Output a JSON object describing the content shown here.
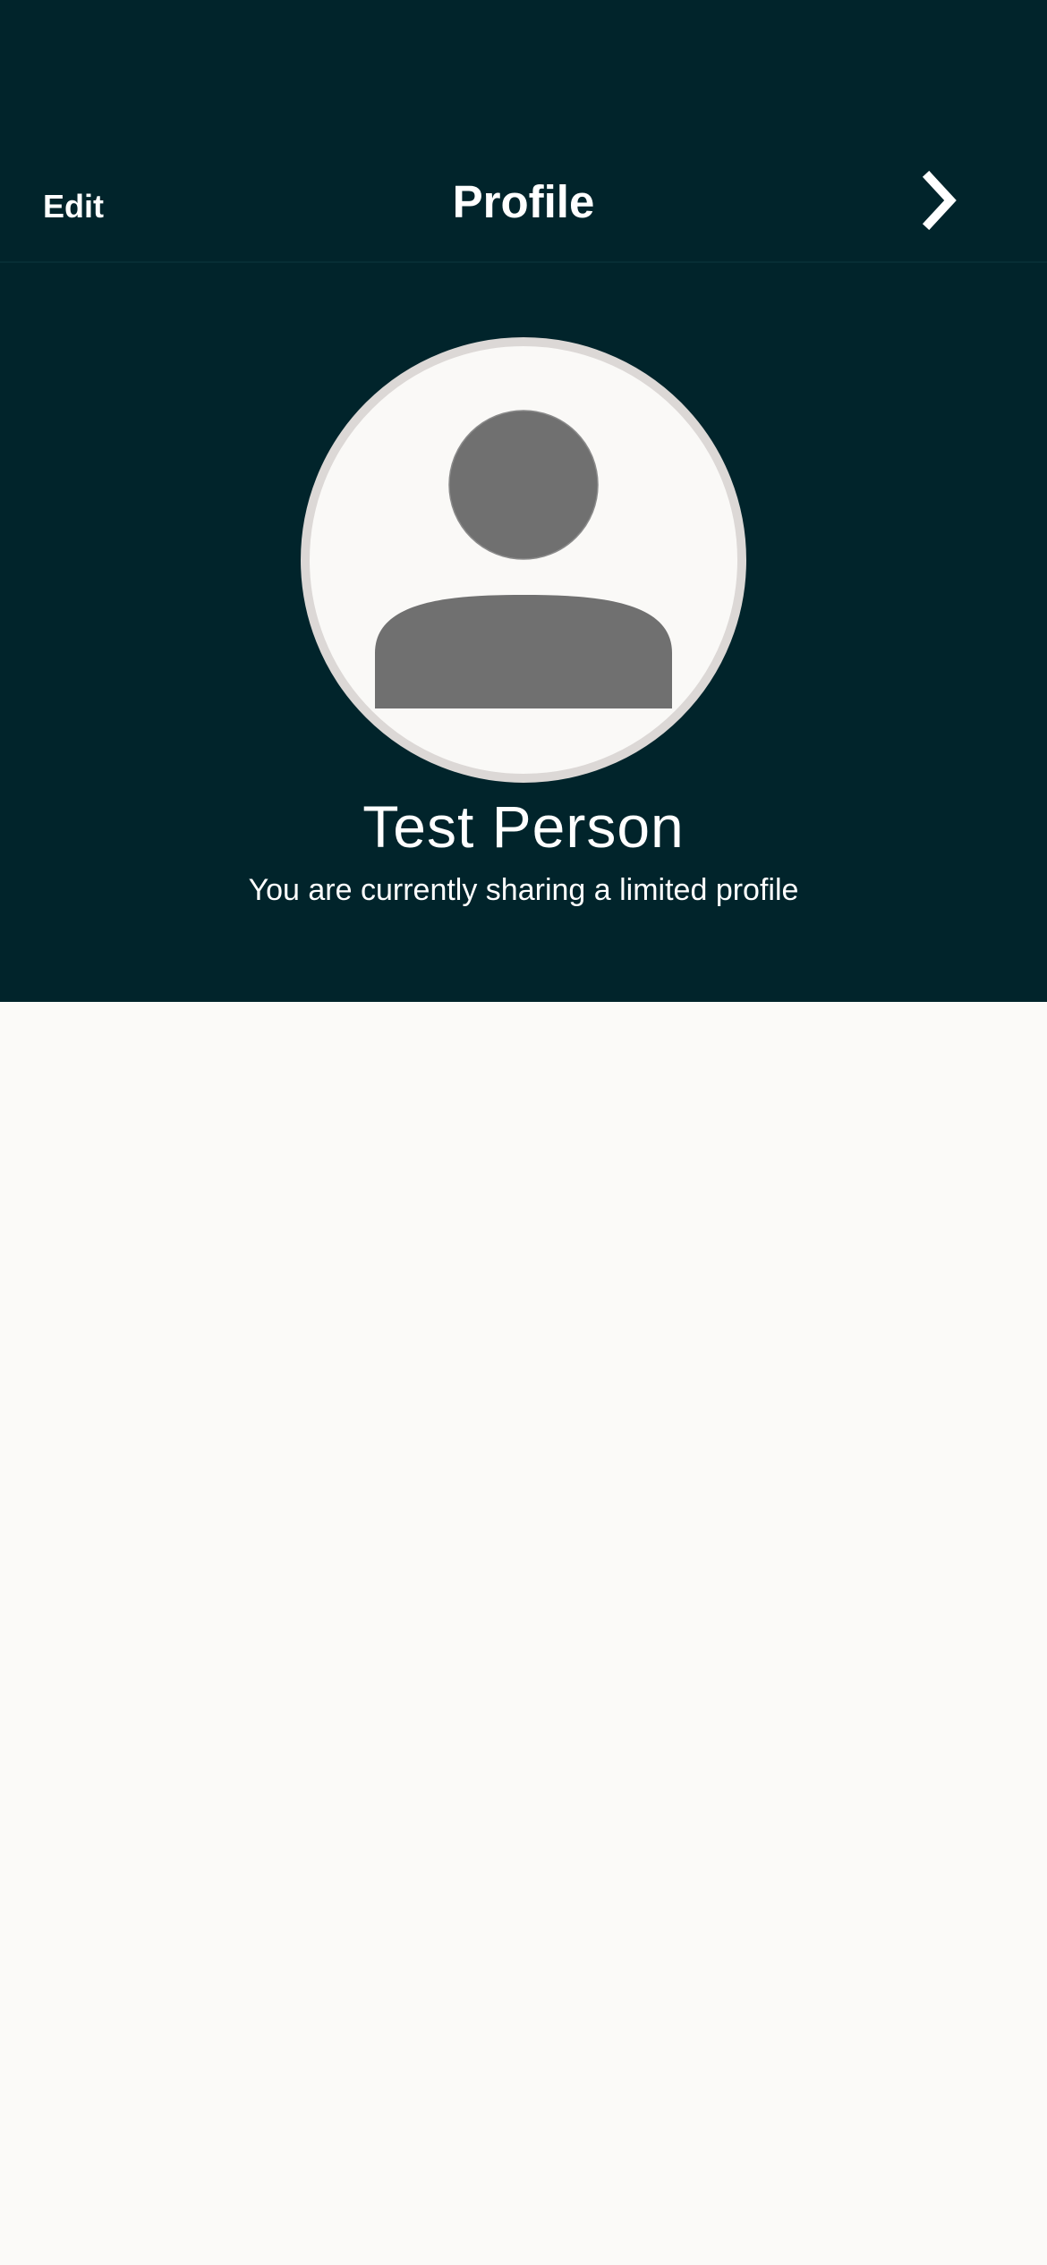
{
  "header": {
    "edit_label": "Edit",
    "title": "Profile",
    "next_icon": "chevron-right-icon"
  },
  "profile": {
    "name": "Test Person",
    "sharing_status": "You are currently sharing a limited profile",
    "avatar_icon": "person-placeholder-icon"
  },
  "colors": {
    "header_background": "#01242b",
    "page_background": "#fbfaf8",
    "avatar_background": "#faf9f7",
    "avatar_border": "#dcd8d6",
    "avatar_figure": "#707070",
    "text_on_dark": "#ffffff"
  }
}
